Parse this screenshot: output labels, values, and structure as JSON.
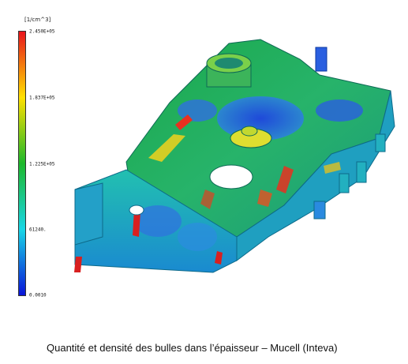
{
  "colorbar": {
    "unit": "[1/cm^3]",
    "ticks": [
      "2.450E+05",
      "1.837E+05",
      "1.225E+05",
      "61240.",
      "0.0010"
    ],
    "colors": {
      "max": "#e8141c",
      "high": "#ffe000",
      "mid": "#1db82b",
      "low": "#18d6e6",
      "min": "#0a14d8"
    }
  },
  "caption": "Quantité et densité des bulles dans l’épaisseur – Mucell (Inteva)"
}
